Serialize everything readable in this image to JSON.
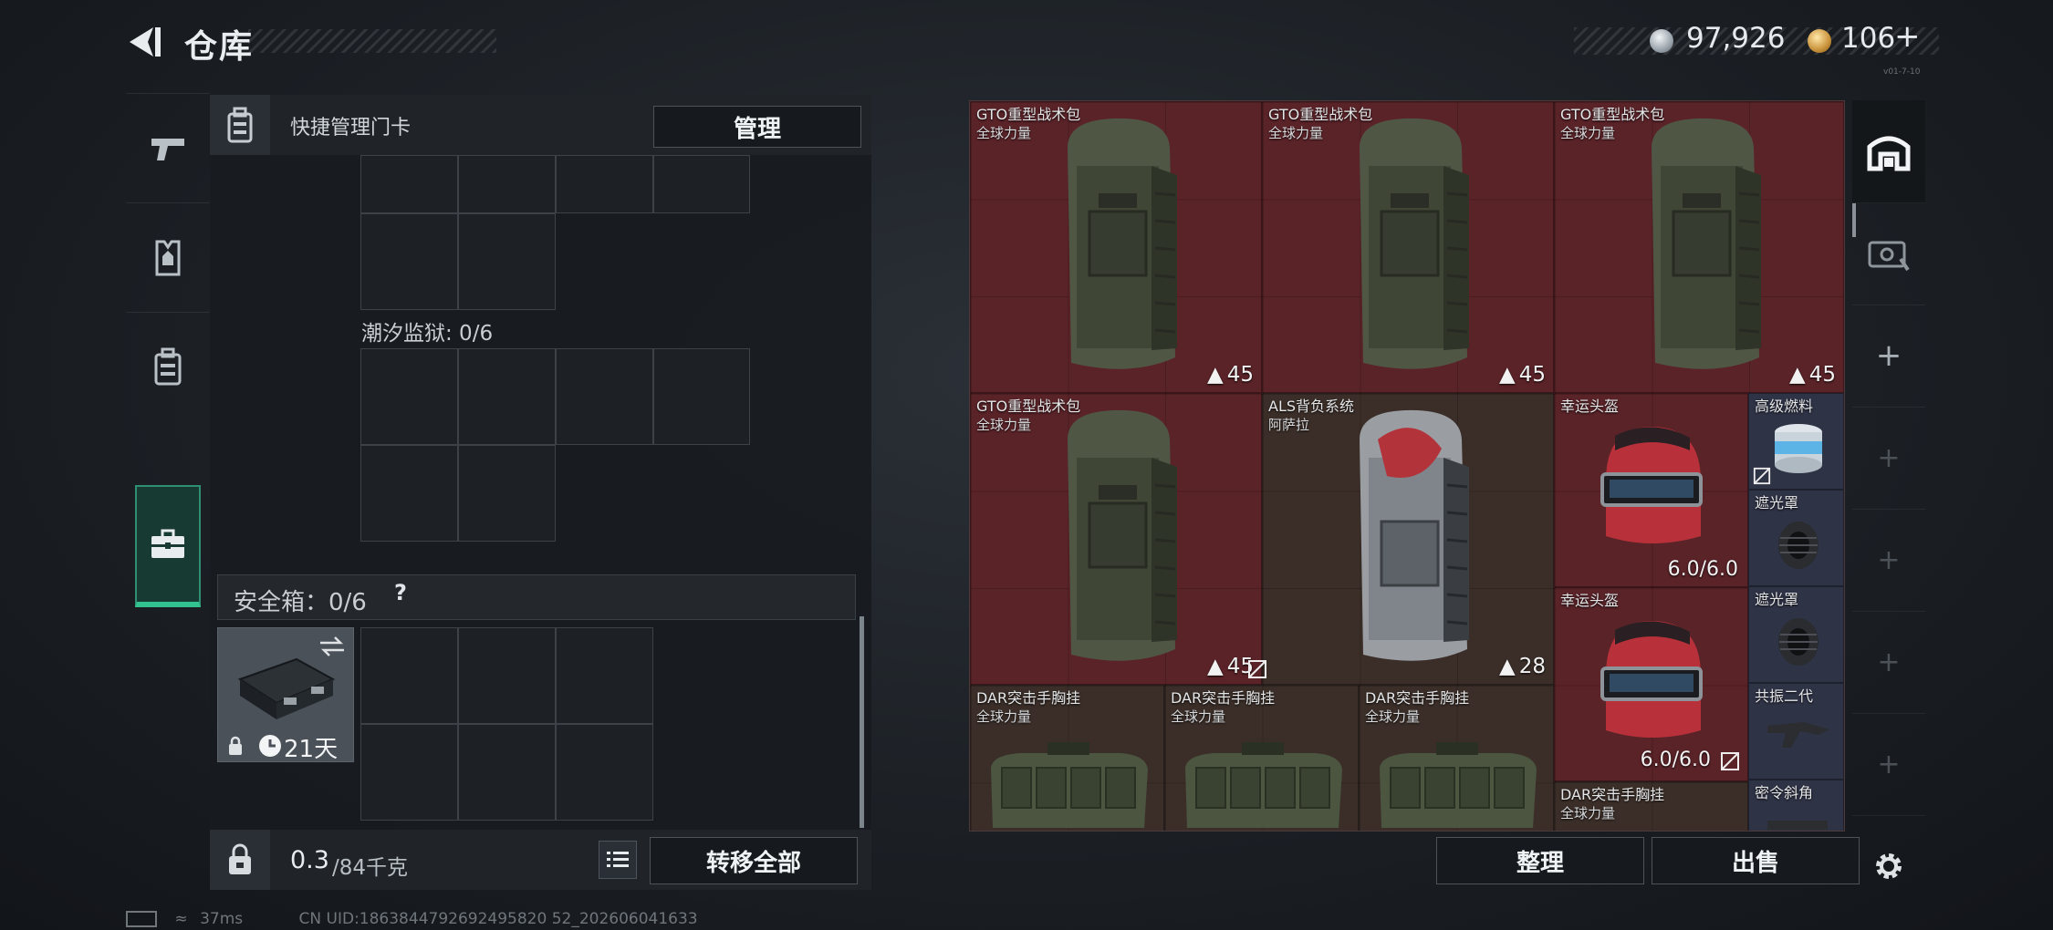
{
  "header": {
    "title": "仓库",
    "coins": "97,926",
    "premium": "106",
    "premium_plus": "+",
    "version": "v01-7-10"
  },
  "left_tabs": [
    {
      "icon": "pistol-icon"
    },
    {
      "icon": "armor-vest-icon"
    },
    {
      "icon": "backpack-icon"
    },
    {
      "icon": "briefcase-icon",
      "active": true
    }
  ],
  "keycard": {
    "label": "快捷管理门卡",
    "manage_button": "管理"
  },
  "sections": {
    "tide_prison": "潮汐监狱: 0/6",
    "safe_box": "安全箱：0/6",
    "help": "?"
  },
  "safe_item": {
    "timer": "21天"
  },
  "footer": {
    "weight_current": "0.3",
    "weight_max": "/84千克",
    "transfer_all": "转移全部"
  },
  "inventory": {
    "items": [
      {
        "name": "GTO重型战术包",
        "sub": "全球力量",
        "capacity": "45"
      },
      {
        "name": "GTO重型战术包",
        "sub": "全球力量",
        "capacity": "45"
      },
      {
        "name": "GTO重型战术包",
        "sub": "全球力量",
        "capacity": "45"
      },
      {
        "name": "GTO重型战术包",
        "sub": "全球力量",
        "capacity": "45"
      },
      {
        "name": "ALS背负系统",
        "sub": "阿萨拉",
        "capacity": "28"
      },
      {
        "name": "幸运头盔",
        "durability": "6.0/6.0"
      },
      {
        "name": "幸运头盔",
        "durability": "6.0/6.0"
      },
      {
        "name": "DAR突击手胸挂",
        "sub": "全球力量"
      },
      {
        "name": "DAR突击手胸挂",
        "sub": "全球力量"
      },
      {
        "name": "DAR突击手胸挂",
        "sub": "全球力量"
      },
      {
        "name": "DAR突击手胸挂",
        "sub": "全球力量"
      }
    ],
    "small_items": [
      {
        "name": "高级燃料"
      },
      {
        "name": "遮光罩"
      },
      {
        "name": "遮光罩"
      },
      {
        "name": "共振二代"
      },
      {
        "name": "密令斜角"
      }
    ],
    "sort_button": "整理",
    "sell_button": "出售"
  },
  "right_rail": [
    {
      "icon": "stash-icon"
    },
    {
      "icon": "ticket-icon"
    },
    {
      "icon": "plus-icon",
      "label": "+"
    },
    {
      "icon": "plus-icon",
      "label": "+"
    },
    {
      "icon": "plus-icon",
      "label": "+"
    },
    {
      "icon": "plus-icon",
      "label": "+"
    },
    {
      "icon": "plus-icon",
      "label": "+"
    }
  ],
  "status_bar": {
    "ping": "37ms",
    "uid": "CN UID:1863844792692495820 52_202606041633"
  }
}
